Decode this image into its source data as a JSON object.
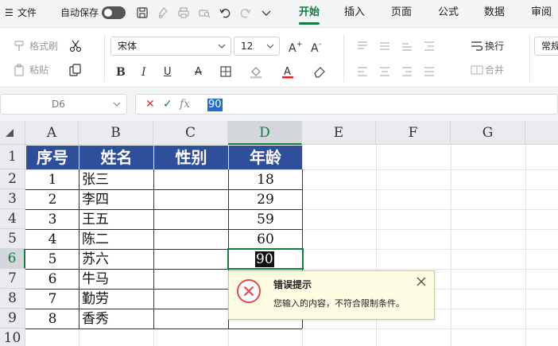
{
  "menubar": {
    "menu_icon": "☰",
    "file_label": "文件",
    "autosave_label": "自动保存",
    "quick_icons": [
      "save-icon",
      "format-painter-icon",
      "print-icon",
      "print-preview-icon",
      "undo-icon",
      "redo-icon",
      "chevron-down-icon"
    ],
    "tabs": [
      "开始",
      "插入",
      "页面",
      "公式",
      "数据",
      "审阅"
    ],
    "active_tab": "开始",
    "accent_color": "#107c41"
  },
  "ribbon": {
    "format_painter": "格式刷",
    "paste": "粘贴",
    "font_name": "宋体",
    "font_size": "12",
    "wrap": "换行",
    "merge": "合并",
    "number_format": "常规",
    "bold": "B",
    "italic": "I",
    "underline": "U",
    "strikethrough": "A",
    "font_color_letter": "A",
    "font_color": "#e02020",
    "icons": [
      "cut-icon",
      "copy-icon",
      "increase-font-icon",
      "decrease-font-icon",
      "border-icon",
      "fill-color-icon",
      "eraser-icon",
      "align-top-icon",
      "align-middle-icon",
      "align-bottom-icon",
      "align-left-icon",
      "align-center-icon",
      "align-right-icon",
      "justify-icon"
    ]
  },
  "formula_bar": {
    "name_box": "D6",
    "cancel": "✕",
    "confirm": "✓",
    "fx": "fx",
    "value": "90"
  },
  "sheet": {
    "columns": [
      "A",
      "B",
      "C",
      "D",
      "E",
      "F",
      "G"
    ],
    "rows": [
      "1",
      "2",
      "3",
      "4",
      "5",
      "6",
      "7",
      "8",
      "9",
      "10"
    ],
    "selected_column": "D",
    "selected_row": "6",
    "header_fill": "#2f4f9a",
    "table": {
      "headers": [
        "序号",
        "姓名",
        "性别",
        "年龄"
      ],
      "records": [
        {
          "no": "1",
          "name": "张三",
          "gender": "",
          "age": "18"
        },
        {
          "no": "2",
          "name": "李四",
          "gender": "",
          "age": "29"
        },
        {
          "no": "3",
          "name": "王五",
          "gender": "",
          "age": "59"
        },
        {
          "no": "4",
          "name": "陈二",
          "gender": "",
          "age": "60"
        },
        {
          "no": "5",
          "name": "苏六",
          "gender": "",
          "age": "90"
        },
        {
          "no": "6",
          "name": "牛马",
          "gender": "",
          "age": ""
        },
        {
          "no": "7",
          "name": "勤劳",
          "gender": "",
          "age": ""
        },
        {
          "no": "8",
          "name": "香秀",
          "gender": "",
          "age": ""
        }
      ]
    },
    "active_cell_value": "90"
  },
  "error_popup": {
    "title": "错误提示",
    "message": "您输入的内容，不符合限制条件。",
    "icon": "error-circle-icon",
    "close_icon": "close-icon",
    "icon_color": "#e24a4a"
  }
}
